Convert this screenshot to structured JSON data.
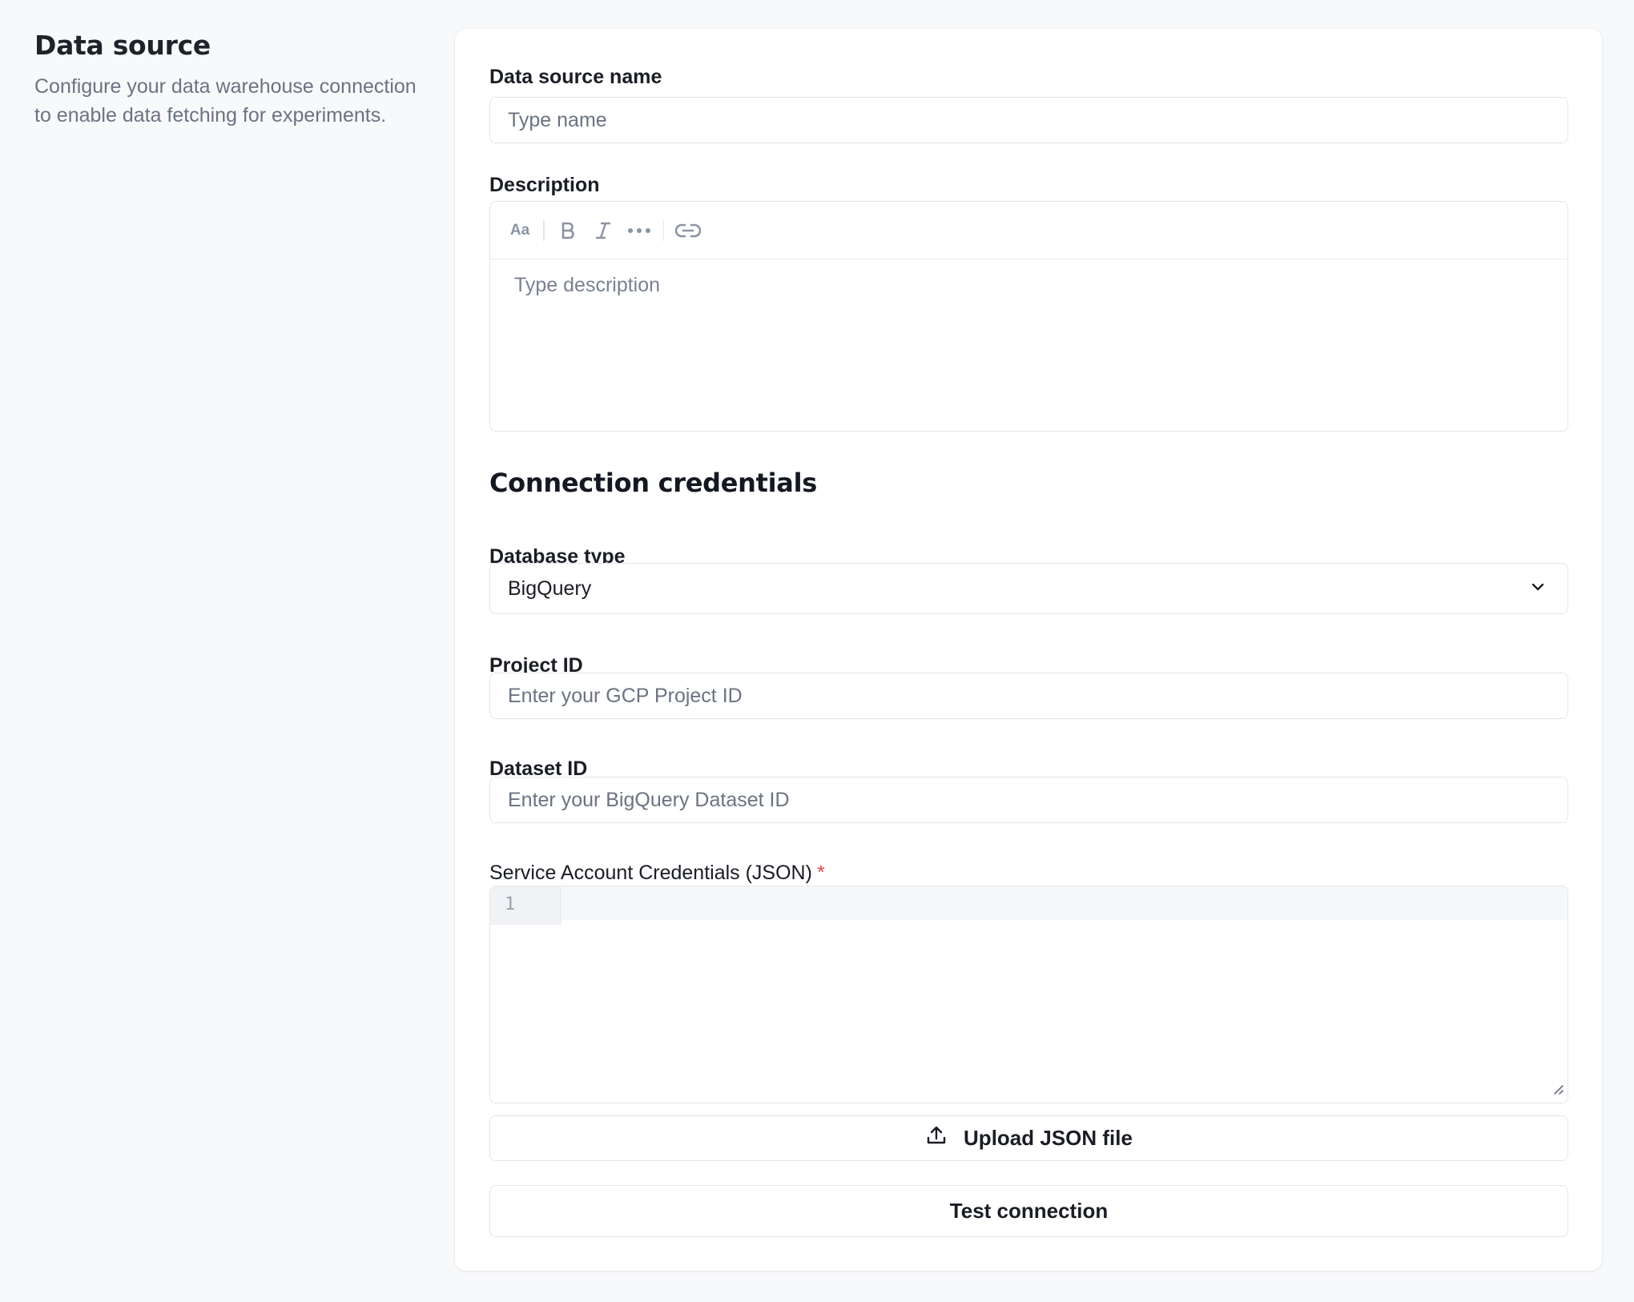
{
  "intro": {
    "title": "Data source",
    "description": "Configure your data warehouse connection to enable data fetching for experiments."
  },
  "form": {
    "name_label": "Data source name",
    "name_placeholder": "Type name",
    "description_label": "Description",
    "description_placeholder": "Type description",
    "toolbar": {
      "text_style_label": "Aa",
      "icons": [
        "bold-icon",
        "italic-icon",
        "more-icon",
        "link-icon"
      ]
    },
    "credentials_title": "Connection credentials",
    "db_type_label": "Database type",
    "db_type_value": "BigQuery",
    "project_label": "Project ID",
    "project_placeholder": "Enter your GCP Project ID",
    "dataset_label": "Dataset ID",
    "dataset_placeholder": "Enter your BigQuery Dataset ID",
    "service_label": "Service Account Credentials (JSON)",
    "required_marker": "*",
    "code_line_number": "1",
    "upload_label": "Upload JSON file",
    "test_label": "Test connection"
  },
  "colors": {
    "background": "#f8f9fb",
    "card": "#ffffff",
    "border": "#e3e6eb",
    "required": "#e5484d",
    "muted_text": "#6b7381"
  }
}
